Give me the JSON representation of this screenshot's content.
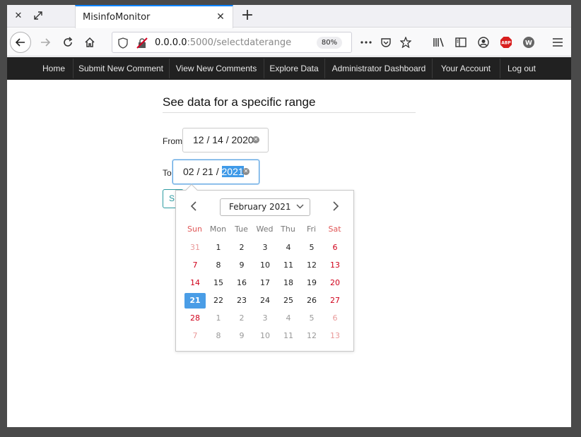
{
  "browser": {
    "tab_title": "MisinfoMonitor",
    "url_host": "0.0.0.0",
    "url_rest": ":5000/selectdaterange",
    "zoom": "80%"
  },
  "sitenav": {
    "items": [
      {
        "label": "Home"
      },
      {
        "label": "Submit New Comment"
      },
      {
        "label": "View New Comments"
      },
      {
        "label": "Explore Data"
      },
      {
        "label": "Administrator Dashboard"
      },
      {
        "label": "Your Account"
      },
      {
        "label": "Log out"
      }
    ]
  },
  "page": {
    "heading": "See data for a specific range",
    "from_label": "From",
    "to_label": "To",
    "from_date": {
      "month": "12",
      "day": "14",
      "year": "2020"
    },
    "to_date": {
      "month": "02",
      "day": "21",
      "year": "2021"
    },
    "submit_stub": "S"
  },
  "picker": {
    "month_label": "February 2021",
    "weekdays": [
      "Sun",
      "Mon",
      "Tue",
      "Wed",
      "Thu",
      "Fri",
      "Sat"
    ],
    "weeks": [
      [
        "31",
        "1",
        "2",
        "3",
        "4",
        "5",
        "6"
      ],
      [
        "7",
        "8",
        "9",
        "10",
        "11",
        "12",
        "13"
      ],
      [
        "14",
        "15",
        "16",
        "17",
        "18",
        "19",
        "20"
      ],
      [
        "21",
        "22",
        "23",
        "24",
        "25",
        "26",
        "27"
      ],
      [
        "28",
        "1",
        "2",
        "3",
        "4",
        "5",
        "6"
      ],
      [
        "7",
        "8",
        "9",
        "10",
        "11",
        "12",
        "13"
      ]
    ],
    "selected_day": "21"
  }
}
